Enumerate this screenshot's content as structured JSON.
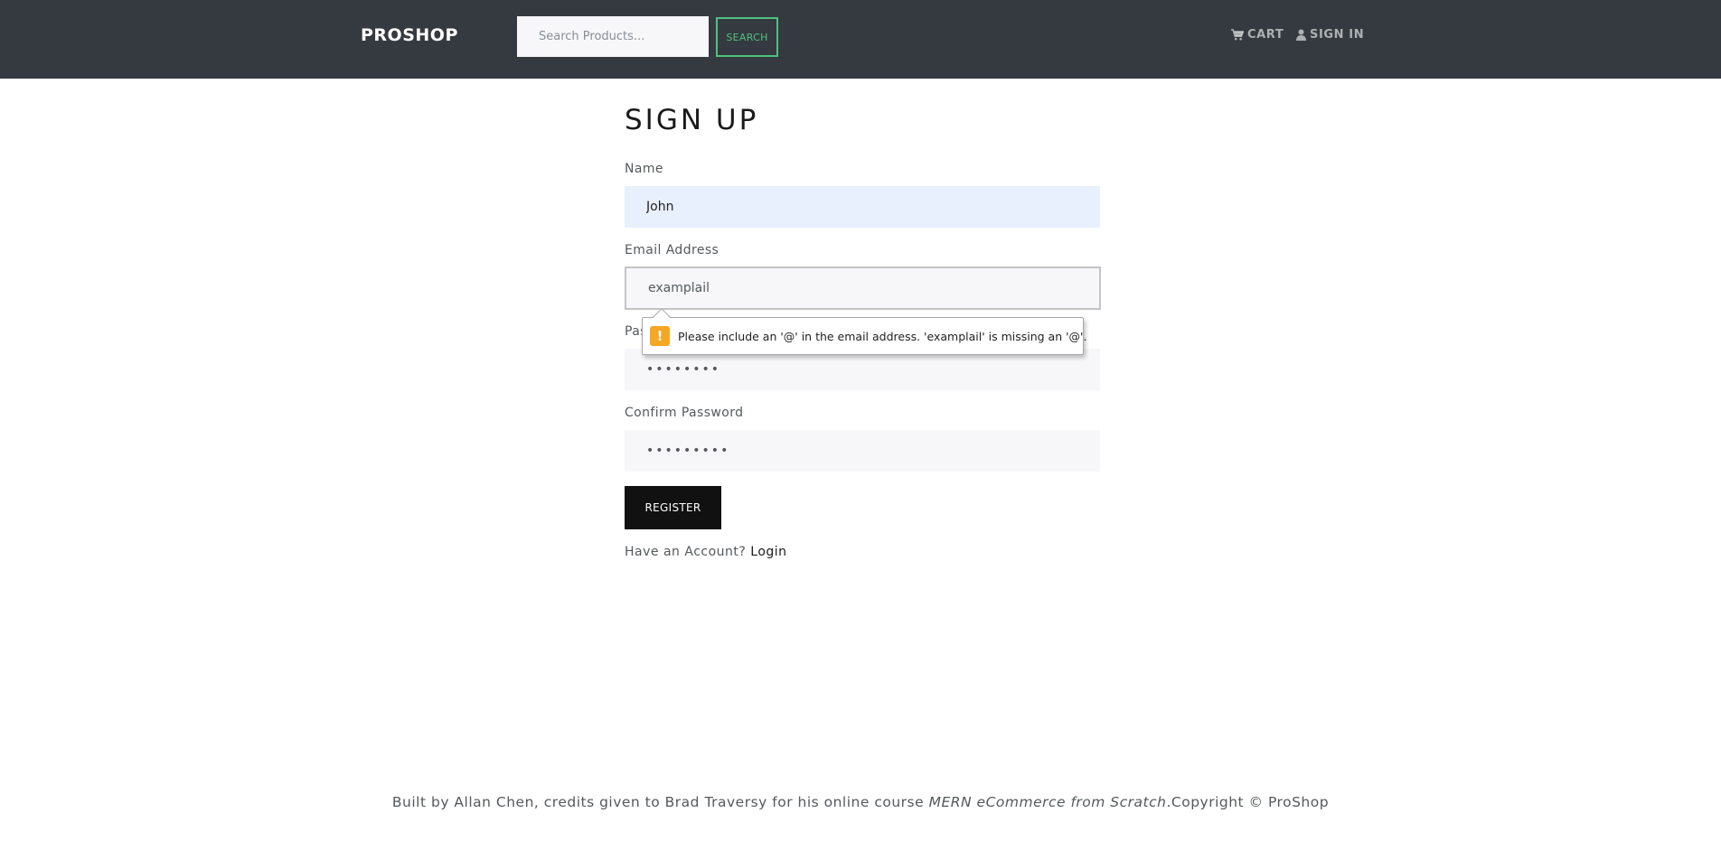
{
  "header": {
    "brand": "PROSHOP",
    "search": {
      "placeholder": "Search Products...",
      "value": ""
    },
    "search_button": "SEARCH",
    "cart_label": "CART",
    "signin_label": "SIGN IN",
    "colors": {
      "background": "#343a40",
      "accent": "#51c17f"
    }
  },
  "form": {
    "title": "SIGN UP",
    "fields": {
      "name": {
        "label": "Name",
        "value": "John"
      },
      "email": {
        "label": "Email Address",
        "value": "examplail"
      },
      "password": {
        "label": "Password",
        "value": "••••••••"
      },
      "confirm": {
        "label": "Confirm Password",
        "value": "•••••••••"
      }
    },
    "register_button": "REGISTER",
    "account_prompt": "Have an Account?",
    "login_link": "Login"
  },
  "validation": {
    "message": "Please include an '@' in the email address. 'examplail' is missing an '@'.",
    "icon": "warning-icon",
    "icon_glyph": "!"
  },
  "footer": {
    "prefix": "Built by Allan Chen, credits given to Brad Traversy for his online course ",
    "course": "MERN eCommerce from Scratch",
    "suffix": ".Copyright © ProShop"
  }
}
